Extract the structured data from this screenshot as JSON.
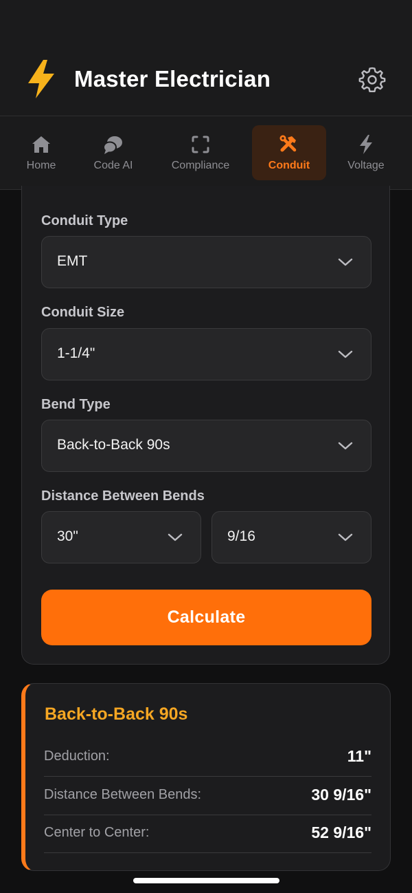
{
  "header": {
    "title": "Master Electrician"
  },
  "nav": {
    "items": [
      {
        "label": "Home",
        "icon": "home-icon"
      },
      {
        "label": "Code AI",
        "icon": "chat-bubbles-icon"
      },
      {
        "label": "Compliance",
        "icon": "scan-frame-icon"
      },
      {
        "label": "Conduit",
        "icon": "tools-icon",
        "active": true
      },
      {
        "label": "Voltage",
        "icon": "lightning-icon"
      }
    ]
  },
  "form": {
    "conduit_type": {
      "label": "Conduit Type",
      "value": "EMT"
    },
    "conduit_size": {
      "label": "Conduit Size",
      "value": "1-1/4\""
    },
    "bend_type": {
      "label": "Bend Type",
      "value": "Back-to-Back 90s"
    },
    "distance": {
      "label": "Distance Between Bends",
      "inches": "30\"",
      "fraction": "9/16"
    },
    "calculate_label": "Calculate"
  },
  "result": {
    "title": "Back-to-Back 90s",
    "rows": [
      {
        "label": "Deduction:",
        "value": "11\""
      },
      {
        "label": "Distance Between Bends:",
        "value": "30 9/16\""
      },
      {
        "label": "Center to Center:",
        "value": "52 9/16\""
      }
    ]
  },
  "colors": {
    "accent": "#ff6f0a",
    "accent_text": "#ff7a1a",
    "result_title": "#f5a623",
    "background": "#101011",
    "card": "#1c1c1e"
  }
}
